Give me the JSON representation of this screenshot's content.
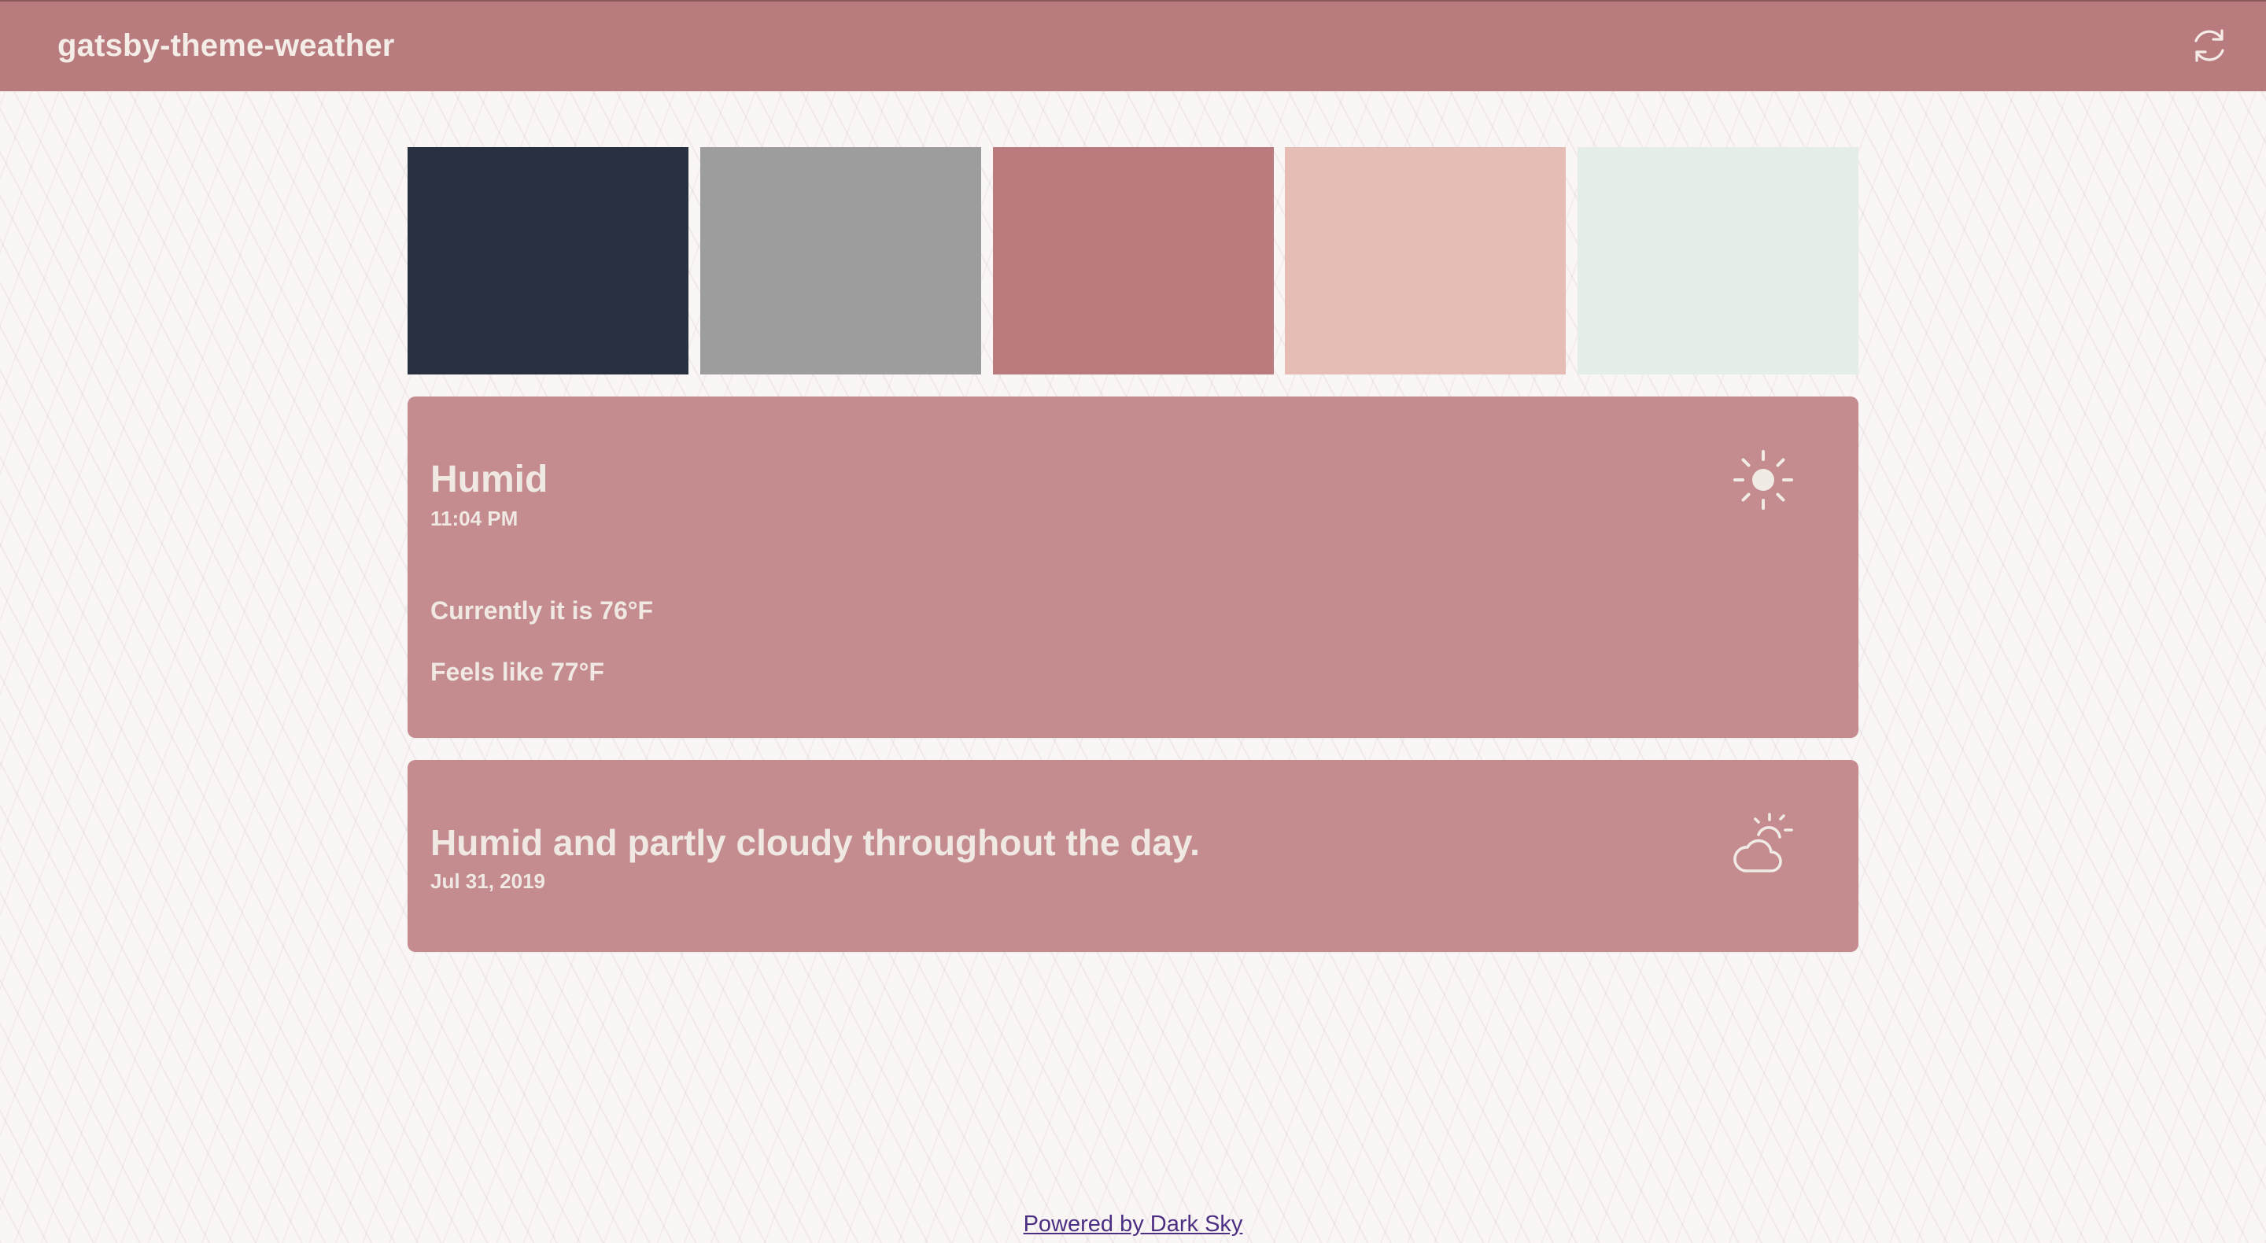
{
  "header": {
    "title": "gatsby-theme-weather",
    "refresh_icon": "refresh-icon"
  },
  "palette": {
    "colors": [
      "#283140",
      "#9e9d9e",
      "#b97b7d",
      "#e6bdb4",
      "#e5eee6"
    ]
  },
  "current_weather": {
    "summary": "Humid",
    "time": "11:04 PM",
    "current_temp": "Currently it is 76°F",
    "feels_like": "Feels like 77°F",
    "icon": "sun-icon"
  },
  "daily_forecast": {
    "summary": "Humid and partly cloudy throughout the day.",
    "date": "Jul 31, 2019",
    "icon": "partly-cloudy-day-icon"
  },
  "footer": {
    "link_text": "Powered by Dark Sky"
  },
  "colors": {
    "header_bg": "#b97c7e",
    "card_bg": "#c48c8f",
    "card_text": "#efe8e3",
    "link": "#4c2e82"
  }
}
